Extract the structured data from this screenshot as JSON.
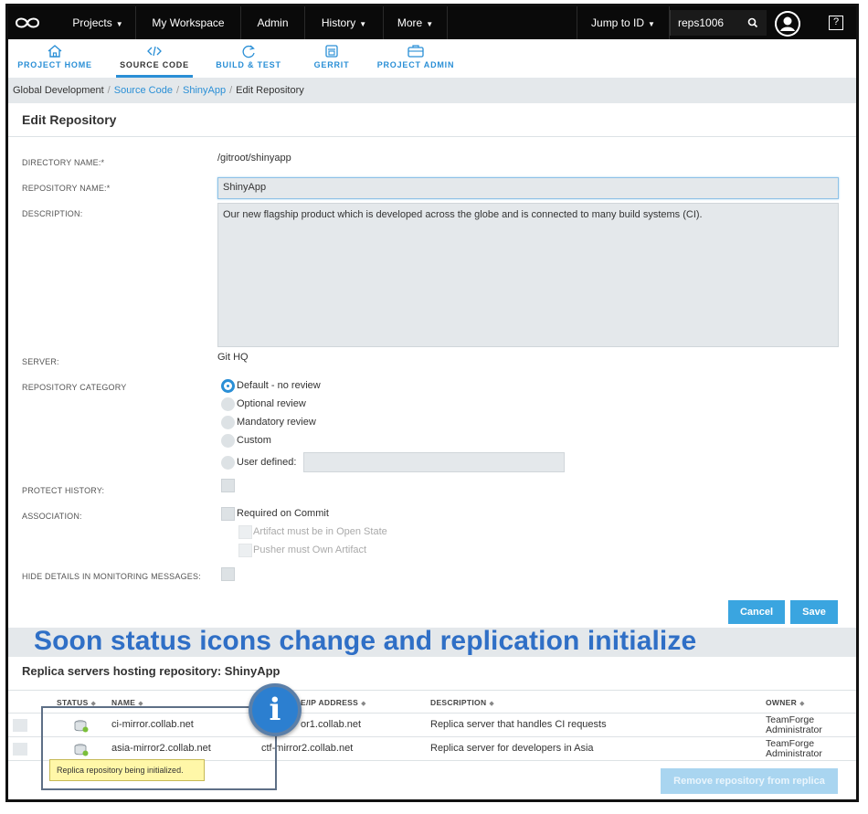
{
  "topnav": {
    "projects": "Projects",
    "my_workspace": "My Workspace",
    "admin": "Admin",
    "history": "History",
    "more": "More",
    "jump_to_id": "Jump to ID",
    "search_value": "reps1006",
    "help": "?"
  },
  "subnav": {
    "tabs": [
      {
        "label": "PROJECT HOME",
        "icon": "home-icon"
      },
      {
        "label": "SOURCE CODE",
        "icon": "code-icon"
      },
      {
        "label": "BUILD & TEST",
        "icon": "refresh-icon"
      },
      {
        "label": "GERRIT",
        "icon": "gerrit-icon"
      },
      {
        "label": "PROJECT ADMIN",
        "icon": "briefcase-icon"
      }
    ]
  },
  "breadcrumb": {
    "items": [
      "Global Development",
      "Source Code",
      "ShinyApp",
      "Edit Repository"
    ]
  },
  "page": {
    "title": "Edit Repository"
  },
  "form": {
    "directory_label": "DIRECTORY NAME:*",
    "directory_value": "/gitroot/shinyapp",
    "repo_name_label": "REPOSITORY NAME:*",
    "repo_name_value": "ShinyApp",
    "description_label": "DESCRIPTION:",
    "description_value": "Our new flagship product which is developed across the globe and is connected to many build systems (CI).",
    "server_label": "SERVER:",
    "server_value": "Git HQ",
    "category_label": "REPOSITORY CATEGORY",
    "category_options": [
      "Default - no review",
      "Optional review",
      "Mandatory review",
      "Custom",
      "User defined:"
    ],
    "category_selected": "Default - no review",
    "protect_label": "PROTECT HISTORY:",
    "association_label": "ASSOCIATION:",
    "required_on_commit": "Required on Commit",
    "artifact_open": "Artifact must be in Open State",
    "pusher_own": "Pusher must Own Artifact",
    "hide_details_label": "HIDE DETAILS IN MONITORING MESSAGES:",
    "cancel": "Cancel",
    "save": "Save"
  },
  "banner": {
    "text": "Soon status icons change and replication initialize"
  },
  "replicas": {
    "title": "Replica servers hosting repository: ShinyApp",
    "columns": [
      "STATUS",
      "NAME",
      "E/IP ADDRESS",
      "DESCRIPTION",
      "OWNER"
    ],
    "rows": [
      {
        "name": "ci-mirror.collab.net",
        "address": "or1.collab.net",
        "description": "Replica server that handles CI requests",
        "owner_line1": "TeamForge",
        "owner_line2": "Administrator"
      },
      {
        "name": "asia-mirror2.collab.net",
        "address": "ctf-mirror2.collab.net",
        "description": "Replica server for developers in Asia",
        "owner_line1": "TeamForge",
        "owner_line2": "Administrator"
      }
    ],
    "tooltip": "Replica repository being initialized.",
    "remove_button": "Remove repository from replica",
    "info_glyph": "i"
  },
  "colors": {
    "accent": "#2a8fd6",
    "banner_text": "#2f6fc6",
    "tooltip_bg": "#fff7a8"
  }
}
